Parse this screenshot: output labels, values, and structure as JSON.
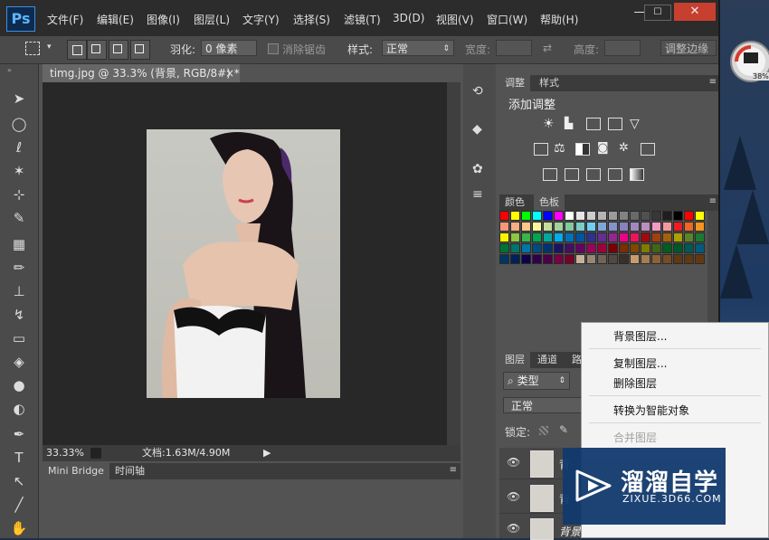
{
  "app": {
    "logo": "Ps"
  },
  "menu": [
    "文件(F)",
    "编辑(E)",
    "图像(I)",
    "图层(L)",
    "文字(Y)",
    "选择(S)",
    "滤镜(T)",
    "3D(D)",
    "视图(V)",
    "窗口(W)",
    "帮助(H)"
  ],
  "window_buttons": {
    "minimize": "—",
    "maximize": "☐",
    "close": "✕"
  },
  "options": {
    "feather_label": "羽化:",
    "feather_value": "0 像素",
    "antialias_label": "消除锯齿",
    "style_label": "样式:",
    "style_value": "正常",
    "width_label": "宽度:",
    "height_label": "高度:",
    "refine_edge_button": "调整边缘"
  },
  "document": {
    "tab_title": "timg.jpg @ 33.3% (背景, RGB/8#) *",
    "tab_close": "×",
    "zoom": "33.33%",
    "doc_size": "文档:1.63M/4.90M"
  },
  "bottom_panel": {
    "tabs": [
      "Mini Bridge",
      "时间轴"
    ]
  },
  "adjustments_panel": {
    "tabs": [
      "调整",
      "样式"
    ],
    "title": "添加调整"
  },
  "swatches_panel": {
    "tabs": [
      "颜色",
      "色板"
    ]
  },
  "layers_panel": {
    "tabs": [
      "图层",
      "通道",
      "路"
    ],
    "filter_label": "类型",
    "blend_mode": "正常",
    "lock_label": "锁定:",
    "layers": [
      "背",
      "背",
      "背景"
    ]
  },
  "context_menu": {
    "items": [
      "背景图层...",
      "复制图层...",
      "删除图层",
      "转换为智能对象",
      "合并图层"
    ],
    "disabled": [
      false,
      false,
      false,
      false,
      true
    ]
  },
  "watermark": {
    "title": "溜溜自学",
    "subtitle": "ZIXUE.3D66.COM"
  },
  "gadget": {
    "value": "38%"
  },
  "colors": {
    "swatch_rows": [
      [
        "#ff0000",
        "#ffff00",
        "#00ff00",
        "#00ffff",
        "#0000ff",
        "#ff00ff",
        "#ffffff",
        "#e6e6e6",
        "#cdcdcd",
        "#b4b4b4",
        "#9b9b9b",
        "#828282",
        "#696969",
        "#505050",
        "#373737",
        "#1e1e1e",
        "#000000",
        "#ff0000",
        "#ffff00"
      ],
      [
        "#f7977a",
        "#f9ad81",
        "#fdc68a",
        "#fff79a",
        "#c4df9b",
        "#a2d39c",
        "#82ca9d",
        "#7bcdc8",
        "#6ecff6",
        "#7ea7d8",
        "#8493ca",
        "#8882be",
        "#a187be",
        "#bc8dbf",
        "#f49ac2",
        "#f6989d",
        "#ed1c24",
        "#f26522",
        "#f7941d"
      ],
      [
        "#fff200",
        "#8dc63f",
        "#39b54a",
        "#00a651",
        "#00a99d",
        "#00aeef",
        "#0072bc",
        "#0054a6",
        "#2e3192",
        "#662d91",
        "#92278f",
        "#ec008c",
        "#ed145b",
        "#9e0b0f",
        "#a0410d",
        "#a36209",
        "#aba000",
        "#598527",
        "#197b30"
      ],
      [
        "#007236",
        "#00746b",
        "#0076a3",
        "#004b80",
        "#003471",
        "#1b1464",
        "#440e62",
        "#630460",
        "#9e005d",
        "#9e0039",
        "#790000",
        "#7b2e00",
        "#7d4900",
        "#827b00",
        "#406618",
        "#005e20",
        "#005826",
        "#005952",
        "#005b7f"
      ],
      [
        "#003663",
        "#002157",
        "#0d004c",
        "#32004b",
        "#4b0049",
        "#7b0046",
        "#7a0026",
        "#c7b299",
        "#998675",
        "#736357",
        "#534741",
        "#37302a",
        "#c69c6d",
        "#a67c52",
        "#8c6239",
        "#754c24",
        "#603913",
        "#603913",
        "#603913"
      ]
    ],
    "accent_blue": "#1f7dd6",
    "watermark_bg": "#123a6e"
  }
}
